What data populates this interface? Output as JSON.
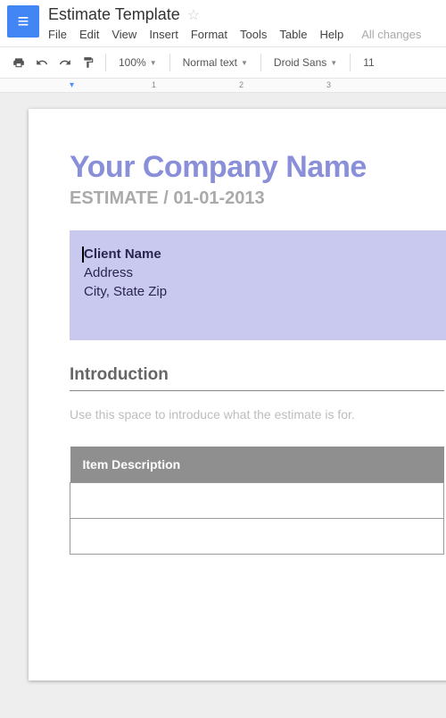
{
  "doc": {
    "title": "Estimate Template"
  },
  "menu": {
    "file": "File",
    "edit": "Edit",
    "view": "View",
    "insert": "Insert",
    "format": "Format",
    "tools": "Tools",
    "table": "Table",
    "help": "Help",
    "status": "All changes"
  },
  "toolbar": {
    "zoom": "100%",
    "style": "Normal text",
    "font": "Droid Sans",
    "size": "11"
  },
  "ruler": {
    "marks": [
      "1",
      "2",
      "3"
    ]
  },
  "content": {
    "company": "Your Company Name",
    "estimate_label": "ESTIMATE",
    "estimate_sep": " / ",
    "estimate_date": "01-01-2013",
    "client": {
      "name": "Client Name",
      "address": "Address",
      "citystate": "City, State Zip"
    },
    "intro_heading": "Introduction",
    "intro_text": "Use this space to introduce what the estimate is for.",
    "table_header": "Item Description"
  }
}
